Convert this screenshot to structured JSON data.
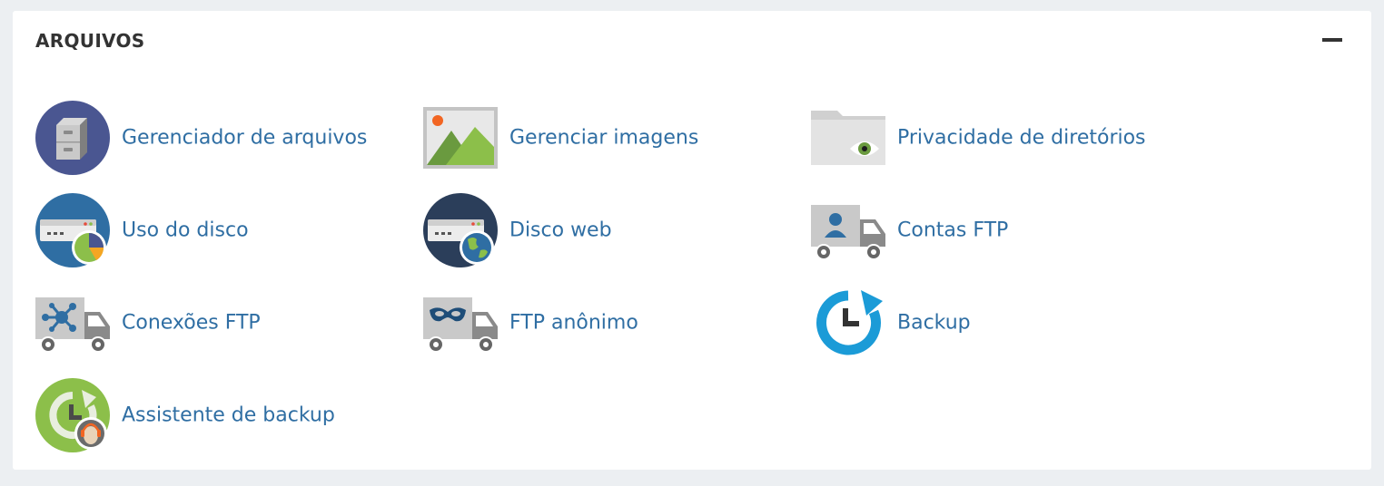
{
  "section": {
    "title": "ARQUIVOS",
    "collapse_icon": "minus-icon"
  },
  "items": [
    {
      "label": "Gerenciador de arquivos",
      "icon": "file-manager-icon"
    },
    {
      "label": "Gerenciar imagens",
      "icon": "images-icon"
    },
    {
      "label": "Privacidade de diretórios",
      "icon": "directory-privacy-icon"
    },
    {
      "label": "Uso do disco",
      "icon": "disk-usage-icon"
    },
    {
      "label": "Disco web",
      "icon": "web-disk-icon"
    },
    {
      "label": "Contas FTP",
      "icon": "ftp-accounts-icon"
    },
    {
      "label": "Conexões FTP",
      "icon": "ftp-connections-icon"
    },
    {
      "label": "FTP anônimo",
      "icon": "anonymous-ftp-icon"
    },
    {
      "label": "Backup",
      "icon": "backup-icon"
    },
    {
      "label": "Assistente de backup",
      "icon": "backup-wizard-icon"
    }
  ],
  "colors": {
    "link": "#2f6ea3",
    "title": "#333333",
    "background": "#eceff2",
    "panel": "#ffffff"
  }
}
